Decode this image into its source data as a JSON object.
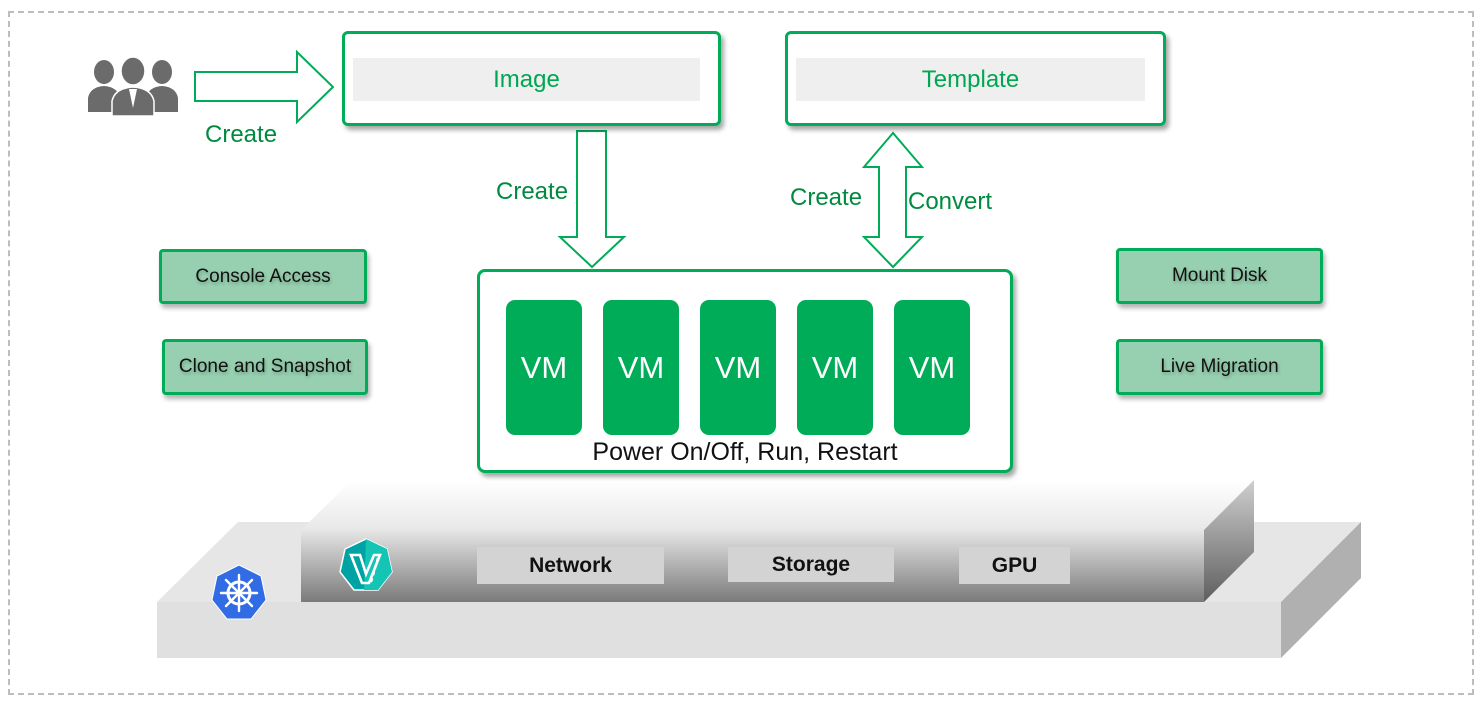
{
  "diagram": {
    "actor": {
      "icon": "users-icon",
      "action_label": "Create"
    },
    "image_box": {
      "label": "Image"
    },
    "template_box": {
      "label": "Template"
    },
    "image_to_vm": {
      "label": "Create"
    },
    "template_vm_link": {
      "left_label": "Create",
      "right_label": "Convert"
    },
    "features_left": [
      {
        "label": "Console Access"
      },
      {
        "label": "Clone and Snapshot"
      }
    ],
    "features_right": [
      {
        "label": "Mount Disk"
      },
      {
        "label": "Live Migration"
      }
    ],
    "vm_group": {
      "vms": [
        {
          "label": "VM"
        },
        {
          "label": "VM"
        },
        {
          "label": "VM"
        },
        {
          "label": "VM"
        },
        {
          "label": "VM"
        }
      ],
      "caption": "Power On/Off, Run, Restart"
    },
    "platform": {
      "base_icon": "kubernetes-icon",
      "upper_icon": "kubevirt-icon",
      "resources": [
        {
          "label": "Network"
        },
        {
          "label": "Storage"
        },
        {
          "label": "GPU"
        }
      ]
    },
    "colors": {
      "accent_green": "#00ac57",
      "label_green": "#008a40",
      "feature_fill": "#97d0b0",
      "kubernetes_blue": "#326ce5",
      "kubevirt_teal": "#00a3a3"
    }
  }
}
